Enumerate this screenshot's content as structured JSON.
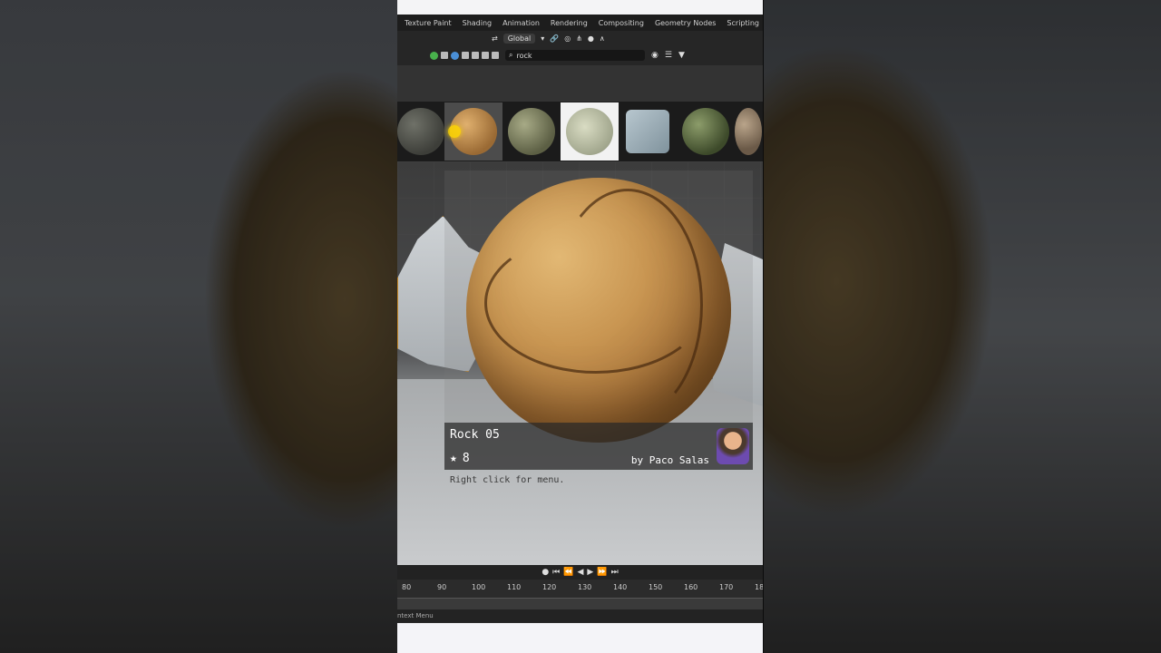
{
  "menu": [
    "Texture Paint",
    "Shading",
    "Animation",
    "Rendering",
    "Compositing",
    "Geometry Nodes",
    "Scripting",
    "+"
  ],
  "toolbar": {
    "orientation": "Global"
  },
  "search": {
    "value": "rock"
  },
  "asset": {
    "title": "Rock 05",
    "rating": "8",
    "author": "by Paco Salas",
    "hint": "Right click for menu."
  },
  "timeline": {
    "ticks": [
      "80",
      "90",
      "100",
      "110",
      "120",
      "130",
      "140",
      "150",
      "160",
      "170",
      "18"
    ]
  },
  "status": {
    "label": "ntext Menu"
  },
  "colors": {
    "accent": "#c88a2a",
    "selected_thumb": "#4c4c4c"
  }
}
